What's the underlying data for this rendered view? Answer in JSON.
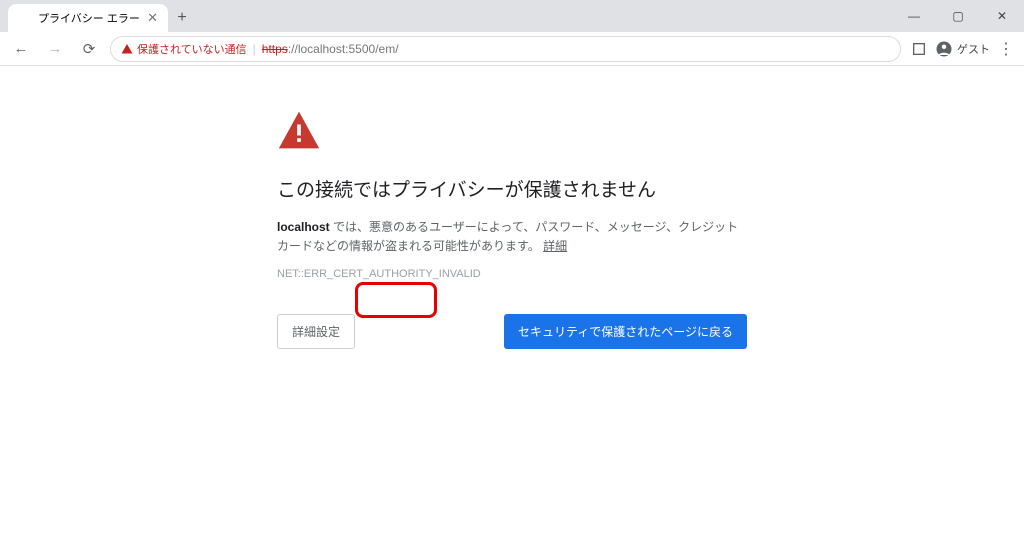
{
  "window": {
    "minimize": "—",
    "maximize": "▢",
    "close": "✕"
  },
  "tab": {
    "title": "プライバシー エラー"
  },
  "nav": {
    "back": "←",
    "forward": "→",
    "reload": "⟳"
  },
  "urlbar": {
    "warning_label": "保護されていない通信",
    "scheme": "https",
    "rest": "://localhost:5500/em/"
  },
  "toolbar": {
    "guest_label": "ゲスト"
  },
  "page": {
    "heading": "この接続ではプライバシーが保護されません",
    "desc_host": "localhost",
    "desc_body": " では、悪意のあるユーザーによって、パスワード、メッセージ、クレジット カードなどの情報が盗まれる可能性があります。",
    "desc_link": "詳細",
    "error_code": "NET::ERR_CERT_AUTHORITY_INVALID",
    "advanced_btn": "詳細設定",
    "back_safe_btn": "セキュリティで保護されたページに戻る"
  }
}
